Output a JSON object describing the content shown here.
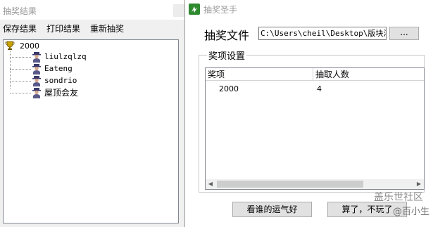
{
  "left_window": {
    "title": "抽奖结果",
    "menu": [
      "保存结果",
      "打印结果",
      "重新抽奖"
    ],
    "tree": {
      "root": "2000",
      "children": [
        "liulzqlzq",
        "Eateng",
        "sondrio",
        "屋顶会友"
      ]
    }
  },
  "dialog": {
    "title": "抽奖圣手",
    "file_label": "抽奖文件",
    "file_path": "C:\\Users\\cheil\\Desktop\\版块活",
    "browse_label": "...",
    "group_label": "奖项设置",
    "columns": [
      "奖项",
      "抽取人数"
    ],
    "rows": [
      {
        "prize": "2000",
        "count": "4"
      }
    ],
    "draw_button": "看谁的运气好",
    "cancel_button": "算了，不玩了",
    "watermark_top": "盖乐世社区",
    "watermark_bottom": "@百小生"
  }
}
